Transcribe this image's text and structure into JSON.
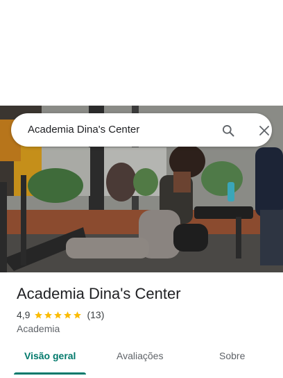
{
  "search": {
    "query": "Academia Dina's Center",
    "search_icon": "search-icon",
    "close_icon": "close-icon"
  },
  "hero": {
    "photo_icon": "gym-photo"
  },
  "place": {
    "title": "Academia Dina's Center",
    "rating": "4,9",
    "rating_value": 4.9,
    "stars_max": 5,
    "reviews": "(13)",
    "category": "Academia"
  },
  "tabs": [
    {
      "label": "Visão geral",
      "active": true
    },
    {
      "label": "Avaliações",
      "active": false
    },
    {
      "label": "Sobre",
      "active": false
    }
  ],
  "colors": {
    "accent": "#00796b",
    "star": "#fbbc04",
    "text": "#202124",
    "secondary": "#5f6368"
  }
}
